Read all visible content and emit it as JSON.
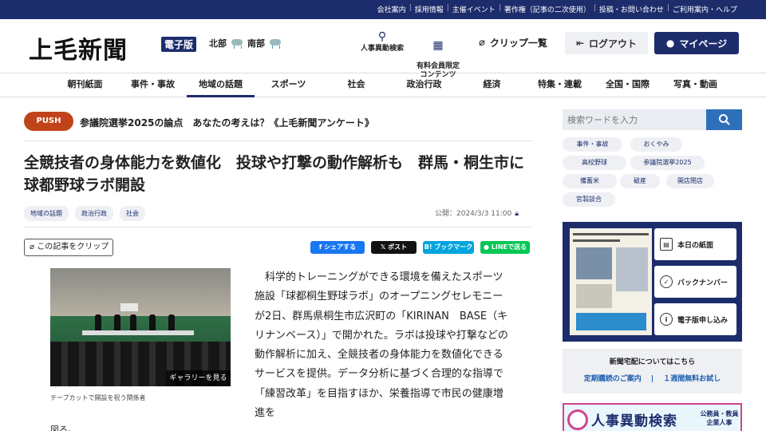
{
  "top_links": [
    "会社案内",
    "採用情報",
    "主催イベント",
    "著作権（記事の二次使用）",
    "投稿・お問い合わせ",
    "ご利用案内・ヘルプ"
  ],
  "header": {
    "logo": "上毛新聞",
    "edition": "電子版",
    "weather_north": "北部",
    "weather_south": "南部",
    "personnel_search": "人事異動検索",
    "premium_content": "有料会員限定\nコンテンツ",
    "clip_list": "クリップ一覧",
    "logout": "ログアウト",
    "mypage": "マイページ"
  },
  "nav": [
    "朝刊紙面",
    "事件・事故",
    "地域の話題",
    "スポーツ",
    "社会",
    "政治行政",
    "経済",
    "特集・連載",
    "全国・国際",
    "写真・動画"
  ],
  "nav_active": "地域の話題",
  "push": {
    "badge": "PUSH",
    "text": "参議院選挙2025の論点　あなたの考えは？《上毛新聞アンケート》"
  },
  "article": {
    "title": "全競技者の身体能力を数値化　投球や打撃の動作解析も　群馬・桐生市に球都野球ラボ開設",
    "tags": [
      "地域の話題",
      "政治行政",
      "社会"
    ],
    "published": "公開：2024/3/3 11:00",
    "clip_button": "この記事をクリップ",
    "share": {
      "facebook": "シェアする",
      "x": "ポスト",
      "hatena": "ブックマーク",
      "line": "LINEで送る"
    },
    "gallery_button": "ギャラリーを見る",
    "caption": "テープカットで開設を祝う関係者",
    "body": "　科学的トレーニングができる環境を備えたスポーツ施設「球都桐生野球ラボ」のオープニングセレモニーが2日、群馬県桐生市広沢町の「KIRINAN　BASE（キリナンベース）」で開かれた。ラボは投球や打撃などの動作解析に加え、全競技者の身体能力を数値化できるサービスを提供。データ分析に基づく合理的な指導で「練習改革」を目指すほか、栄養指導で市民の健康増進を",
    "continuation": "図る。"
  },
  "sidebar": {
    "search_placeholder": "検索ワードを入力",
    "tags": [
      "事件・事故",
      "おくやみ",
      "高校野球",
      "参議院選挙2025",
      "備蓄米",
      "破産",
      "開店閉店",
      "官製談合"
    ],
    "paper_buttons": [
      "本日の紙面",
      "バックナンバー",
      "電子版申し込み"
    ],
    "home_delivery_title": "新聞宅配についてはこちら",
    "home_delivery_link1": "定期購読のご案内",
    "home_delivery_link2": "１週間無料お試し",
    "ad_title": "人事異動検索",
    "ad_sub": "公務員・教員\n企業人事"
  }
}
